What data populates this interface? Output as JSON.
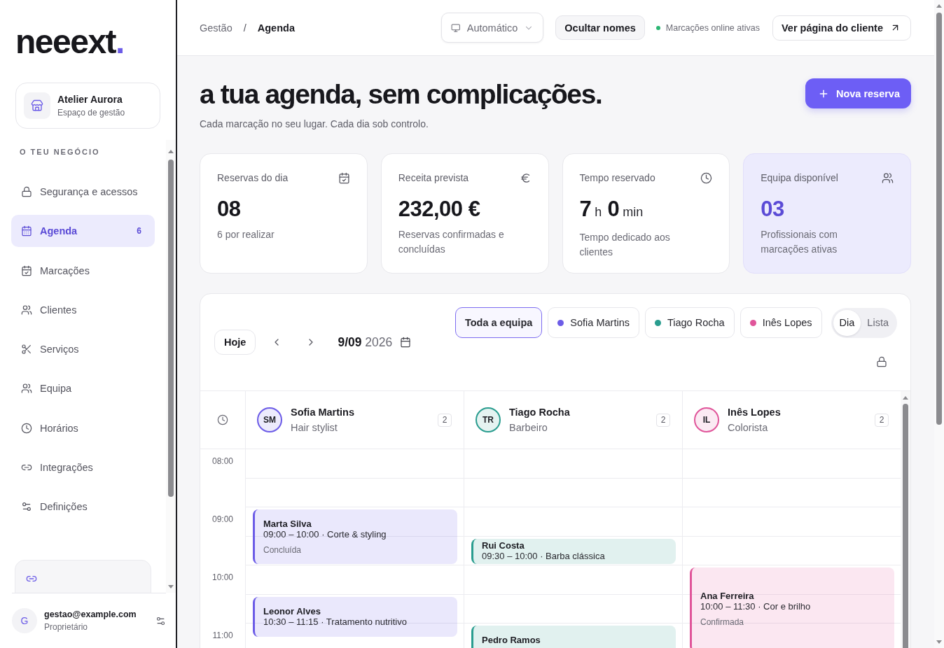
{
  "sidebar": {
    "logo": {
      "word": "neeext",
      "dot": "."
    },
    "workspace": {
      "name": "Atelier Aurora",
      "subtitle": "Espaço de gestão"
    },
    "section_label": "O TEU NEGÓCIO",
    "nav": [
      {
        "label": "Segurança e acessos",
        "selected": false
      },
      {
        "label": "Agenda",
        "selected": true,
        "badge": "6"
      },
      {
        "label": "Marcações",
        "selected": false
      },
      {
        "label": "Clientes",
        "selected": false
      },
      {
        "label": "Serviços",
        "selected": false
      },
      {
        "label": "Equipa",
        "selected": false
      },
      {
        "label": "Horários",
        "selected": false
      },
      {
        "label": "Integrações",
        "selected": false
      },
      {
        "label": "Definições",
        "selected": false
      }
    ],
    "user": {
      "initial": "G",
      "email": "gestao@example.com",
      "role": "Proprietário"
    }
  },
  "header": {
    "breadcrumb": [
      {
        "label": "Gestão",
        "current": false
      },
      {
        "label": "Agenda",
        "current": true
      }
    ],
    "breadcrumb_separator": "/",
    "theme_select": "Automático",
    "hide_names_button": "Ocultar nomes",
    "online_status": {
      "label": "Marcações online ativas",
      "active": true
    },
    "client_page_button": "Ver página do cliente"
  },
  "page": {
    "title": "a tua agenda, sem complicações.",
    "subtitle": "Cada marcação no seu lugar. Cada dia sob controlo.",
    "new_booking_button": "Nova reserva"
  },
  "stats": [
    {
      "kind": "number",
      "label": "Reservas do dia",
      "value": "08",
      "description": "6 por realizar",
      "highlighted": false
    },
    {
      "kind": "number",
      "label": "Receita prevista",
      "value": "232,00 €",
      "description": "Reservas confirmadas e concluídas",
      "highlighted": false
    },
    {
      "kind": "duration",
      "label": "Tempo reservado",
      "value_parts": [
        {
          "number": "7",
          "unit": "h"
        },
        {
          "number": "0",
          "unit": "min"
        }
      ],
      "description": "Tempo dedicado aos clientes",
      "highlighted": false
    },
    {
      "kind": "number",
      "label": "Equipa disponível",
      "value": "03",
      "description": "Profissionais com marcações ativas",
      "highlighted": true
    }
  ],
  "calendar": {
    "today_button": "Hoje",
    "date": "**9/09** 2026",
    "filters": [
      {
        "label": "Toda a equipa",
        "selected": true
      },
      {
        "label": "Sofia Martins",
        "selected": false,
        "color": "#6c5ce7"
      },
      {
        "label": "Tiago Rocha",
        "selected": false,
        "color": "#2a9d8f"
      },
      {
        "label": "Inês Lopes",
        "selected": false,
        "color": "#e0559a"
      }
    ],
    "views": [
      {
        "label": "Dia",
        "selected": true
      },
      {
        "label": "Lista",
        "selected": false
      }
    ],
    "hours": [
      "08:00",
      "09:00",
      "10:00",
      "11:00"
    ],
    "staff": [
      {
        "initials": "SM",
        "name": "Sofia Martins",
        "role": "Hair stylist",
        "count": "2",
        "color": "#6c5ce7",
        "bookings": [
          {
            "client": "Marta Silva",
            "time": "09:00 – 10:00 · Corte & styling",
            "status": "Concluída"
          },
          {
            "client": "Leonor Alves",
            "time": "10:30 – 11:15 · Tratamento nutritivo"
          }
        ]
      },
      {
        "initials": "TR",
        "name": "Tiago Rocha",
        "role": "Barbeiro",
        "count": "2",
        "color": "#2a9d8f",
        "bookings": [
          {
            "client": "Rui Costa",
            "time": "09:30 – 10:00 · Barba clássica"
          },
          {
            "client": "Pedro Ramos"
          }
        ]
      },
      {
        "initials": "IL",
        "name": "Inês Lopes",
        "role": "Colorista",
        "count": "2",
        "color": "#e0559a",
        "bookings": [
          {
            "client": "Ana Ferreira",
            "time": "10:00 – 11:30 · Cor e brilho",
            "status": "Confirmada"
          }
        ]
      }
    ]
  }
}
